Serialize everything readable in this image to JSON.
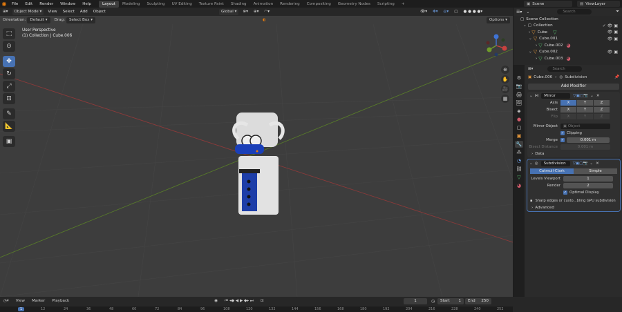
{
  "menu": [
    "File",
    "Edit",
    "Render",
    "Window",
    "Help"
  ],
  "workspaces": [
    "Layout",
    "Modeling",
    "Sculpting",
    "UV Editing",
    "Texture Paint",
    "Shading",
    "Animation",
    "Rendering",
    "Compositing",
    "Geometry Nodes",
    "Scripting",
    "+"
  ],
  "active_workspace": "Layout",
  "scene": "Scene",
  "view_layer": "ViewLayer",
  "viewport": {
    "mode": "Object Mode",
    "header_menu": [
      "View",
      "Select",
      "Add",
      "Object"
    ],
    "transform_orientation": "Global",
    "orientation_label": "Orientation:",
    "orientation_value": "Default",
    "drag_label": "Drag:",
    "drag_value": "Select Box",
    "options": "Options",
    "info_line1": "User Perspective",
    "info_line2": "(1) Collection | Cube.006"
  },
  "outliner": {
    "search_placeholder": "Search",
    "rows": [
      {
        "label": "Scene Collection"
      },
      {
        "label": "Collection"
      },
      {
        "label": "Cube"
      },
      {
        "label": "Cube.001"
      },
      {
        "label": "Cube.002"
      },
      {
        "label": "Cube.002"
      },
      {
        "label": "Cube.003"
      }
    ]
  },
  "properties": {
    "search_placeholder": "Search",
    "object": "Cube.006",
    "modifier_crumb": "Subdivision",
    "add_modifier": "Add Modifier",
    "mirror": {
      "name": "Mirror",
      "axis_label": "Axis",
      "bisect_label": "Bisect",
      "flip_label": "Flip",
      "x": "X",
      "y": "Y",
      "z": "Z",
      "mirror_object_label": "Mirror Object",
      "mirror_object_placeholder": "Object",
      "clipping_label": "Clipping",
      "merge_label": "Merge",
      "merge_value": "0.001 m",
      "bisect_distance_label": "Bisect Distance",
      "bisect_distance_value": "0.001 m",
      "data_label": "Data"
    },
    "subdivision": {
      "name": "Subdivision",
      "catmull": "Catmull-Clark",
      "simple": "Simple",
      "levels_viewport_label": "Levels Viewport",
      "levels_viewport_value": "1",
      "render_label": "Render",
      "render_value": "2",
      "optimal_display_label": "Optimal Display",
      "note": "Sharp edges or custo...bling GPU subdivision",
      "advanced_label": "Advanced"
    }
  },
  "timeline": {
    "menu": [
      "View",
      "Marker",
      "Playback"
    ],
    "current_frame": "1",
    "start_label": "Start",
    "start_value": "1",
    "end_label": "End",
    "end_value": "250",
    "ruler": [
      "1",
      "12",
      "24",
      "36",
      "48",
      "60",
      "72",
      "84",
      "96",
      "108",
      "120",
      "132",
      "144",
      "156",
      "168",
      "180",
      "192",
      "204",
      "216",
      "228",
      "240",
      "252"
    ]
  },
  "colors": {
    "accent": "#4772b3",
    "orange": "#e87d0d",
    "x_axis": "#c9413f",
    "y_axis": "#6f9a2a"
  }
}
